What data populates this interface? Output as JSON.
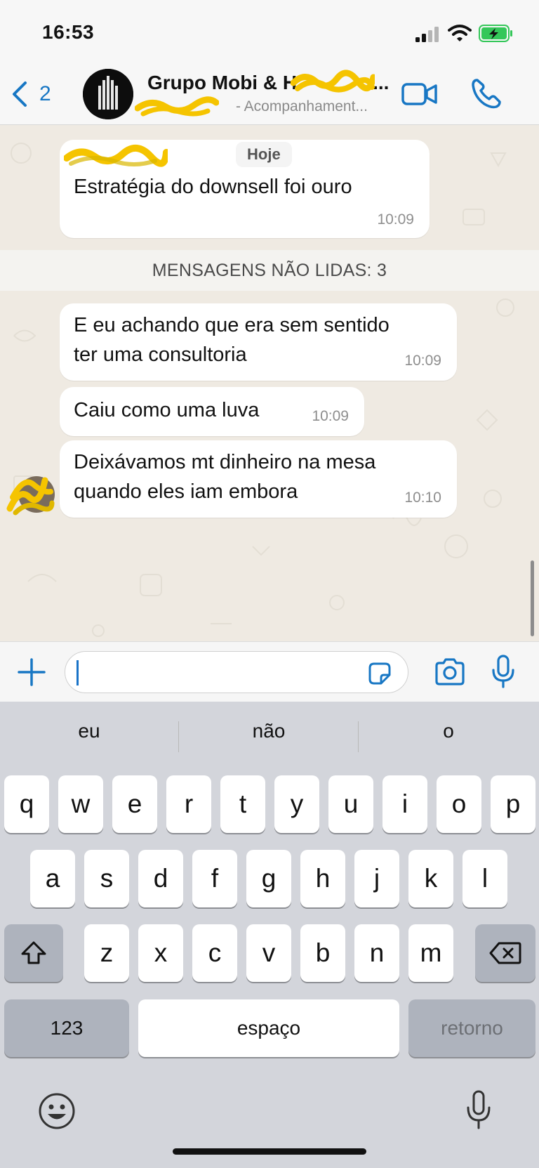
{
  "status_bar": {
    "time": "16:53"
  },
  "header": {
    "back_count": "2",
    "title": "Grupo Mobi & H",
    "title_suffix": "...",
    "subtitle": "- Acompanhament..."
  },
  "chat": {
    "date_chip": "Hoje",
    "messages": [
      {
        "text": "Estratégia do downsell foi ouro",
        "time": "10:09"
      },
      {
        "text": "E eu achando que era sem sentido ter uma consultoria",
        "time": "10:09"
      },
      {
        "text": "Caiu como uma luva",
        "time": "10:09"
      },
      {
        "text": "Deixávamos mt dinheiro na mesa quando eles iam embora",
        "time": "10:10"
      }
    ],
    "unread_banner": "MENSAGENS NÃO LIDAS: 3"
  },
  "input": {
    "value": ""
  },
  "keyboard": {
    "suggestions": [
      "eu",
      "não",
      "o"
    ],
    "row1": [
      "q",
      "w",
      "e",
      "r",
      "t",
      "y",
      "u",
      "i",
      "o",
      "p"
    ],
    "row2": [
      "a",
      "s",
      "d",
      "f",
      "g",
      "h",
      "j",
      "k",
      "l"
    ],
    "row3": [
      "z",
      "x",
      "c",
      "v",
      "b",
      "n",
      "m"
    ],
    "numbers_label": "123",
    "space_label": "espaço",
    "return_label": "retorno"
  },
  "colors": {
    "accent": "#1877c4",
    "chat_background": "#efeae2",
    "bubble": "#ffffff",
    "keyboard_background": "#d3d5db",
    "battery_green": "#34c759",
    "redaction_scribble": "#f5c400"
  },
  "icons": [
    "chevron-left-icon",
    "video-call-icon",
    "phone-icon",
    "plus-icon",
    "sticker-icon",
    "camera-icon",
    "microphone-icon",
    "shift-icon",
    "backspace-icon",
    "emoji-icon",
    "dictation-icon"
  ]
}
